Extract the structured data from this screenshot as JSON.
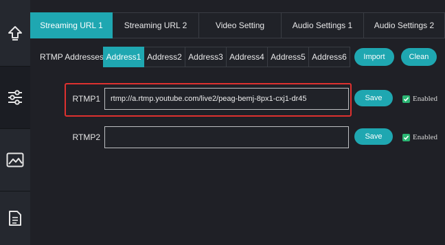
{
  "tabs": [
    {
      "label": "Streaming URL 1",
      "active": true
    },
    {
      "label": "Streaming URL 2",
      "active": false
    },
    {
      "label": "Video Setting",
      "active": false
    },
    {
      "label": "Audio Settings 1",
      "active": false
    },
    {
      "label": "Audio Settings 2",
      "active": false
    }
  ],
  "addresses": {
    "label": "RTMP Addresses",
    "items": [
      "Address1",
      "Address2",
      "Address3",
      "Address4",
      "Address5",
      "Address6"
    ],
    "active_index": 0,
    "import_label": "Import",
    "clean_label": "Clean"
  },
  "rtmp1": {
    "label": "RTMP1",
    "value": "rtmp://a.rtmp.youtube.com/live2/peag-bemj-8px1-cxj1-dr45",
    "save_label": "Save",
    "enabled_label": "Enabled",
    "enabled": true
  },
  "rtmp2": {
    "label": "RTMP2",
    "value": "",
    "save_label": "Save",
    "enabled_label": "Enabled",
    "enabled": true
  },
  "sidebar": {
    "icons": [
      "upload-icon",
      "sliders-icon",
      "image-icon",
      "document-icon"
    ]
  },
  "colors": {
    "accent": "#1fa7b1",
    "highlight": "#e0312f",
    "checkbox": "#2bb673",
    "background": "#20222a"
  }
}
